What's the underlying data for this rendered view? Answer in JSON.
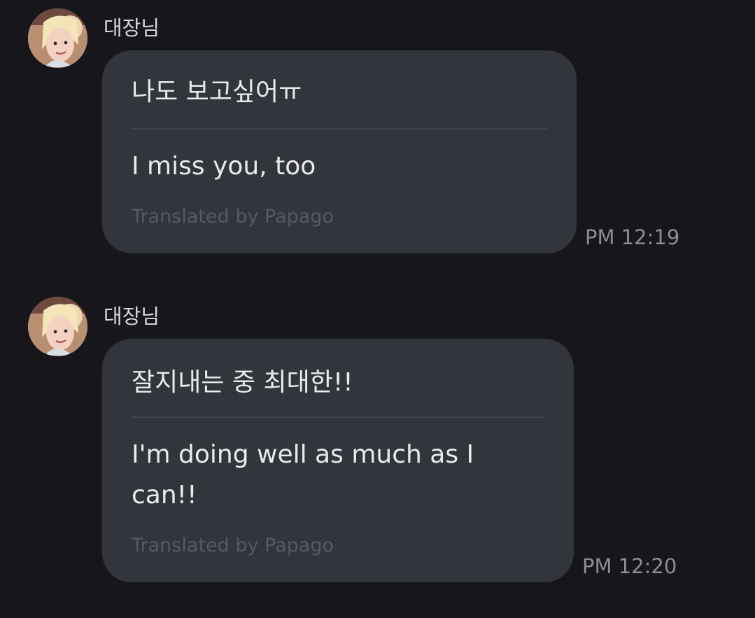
{
  "messages": [
    {
      "sender": "대장님",
      "original": "나도 보고싶어ㅠ",
      "translation": "I miss you, too",
      "credit": "Translated by Papago",
      "time": "PM 12:19"
    },
    {
      "sender": "대장님",
      "original": "잘지내는 중 최대한!!",
      "translation": "I'm doing well as much as I can!!",
      "credit": "Translated by Papago",
      "time": "PM 12:20"
    }
  ],
  "colors": {
    "background": "#17171b",
    "bubble": "#33353d",
    "text": "#e9eaed",
    "muted": "#8b8d96"
  }
}
